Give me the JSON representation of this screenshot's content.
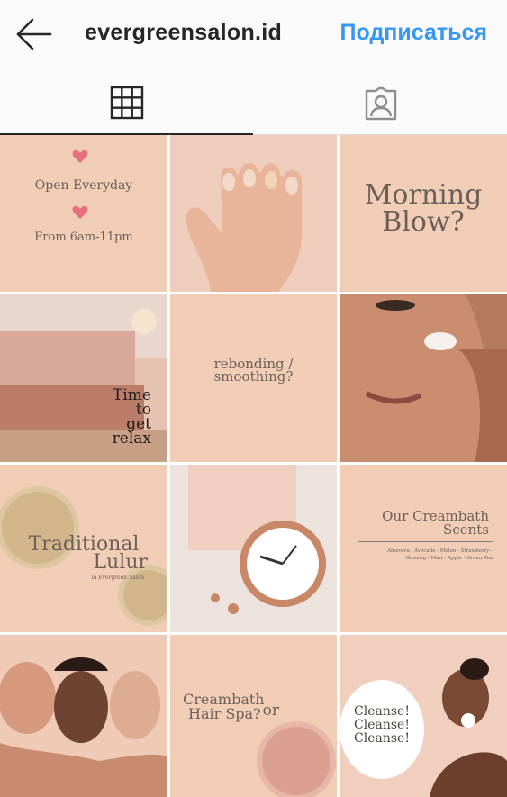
{
  "header": {
    "back_icon": "arrow-left-icon",
    "username": "evergreensalon.id",
    "follow_label": "Подписаться",
    "follow_color": "#3897f0"
  },
  "tabs": [
    {
      "name": "grid",
      "icon": "grid-icon",
      "active": true
    },
    {
      "name": "tagged",
      "icon": "tagged-user-icon",
      "active": false
    }
  ],
  "posts": {
    "p1": {
      "line1": "Open Everyday",
      "line2": "From 6am-11pm",
      "icon": "heart-icon"
    },
    "p2": {
      "image": "hand with nude nails"
    },
    "p3": {
      "line1": "Morning",
      "line2": "Blow?"
    },
    "p4": {
      "line1": "Time",
      "line2": "to",
      "line3": "get",
      "line4": "relax"
    },
    "p5": {
      "line1": "rebonding /",
      "line2": "smoothing?"
    },
    "p6": {
      "image": "woman applying cream"
    },
    "p7": {
      "line1": "Traditional",
      "line2": "Lulur",
      "sub": "in Evergreen Salon"
    },
    "p8": {
      "image": "rose gold clock"
    },
    "p9": {
      "title1": "Our Creambath",
      "title2": "Scents",
      "list1": "Aloevera - Avocado - Melon - Strawberry -",
      "list2": "Ginseng - Mint - Apple - Green Tea"
    },
    "p10": {
      "image": "three smiling women"
    },
    "p11": {
      "line1": "Creambath",
      "line2": "Hair Spa?",
      "suffix": "or"
    },
    "p12": {
      "line1": "Cleanse!",
      "line2": "Cleanse!",
      "line3": "Cleanse!"
    }
  },
  "colors": {
    "peach": "#f2cdb6",
    "heart": "#e8707e",
    "text": "#6b5f57"
  }
}
